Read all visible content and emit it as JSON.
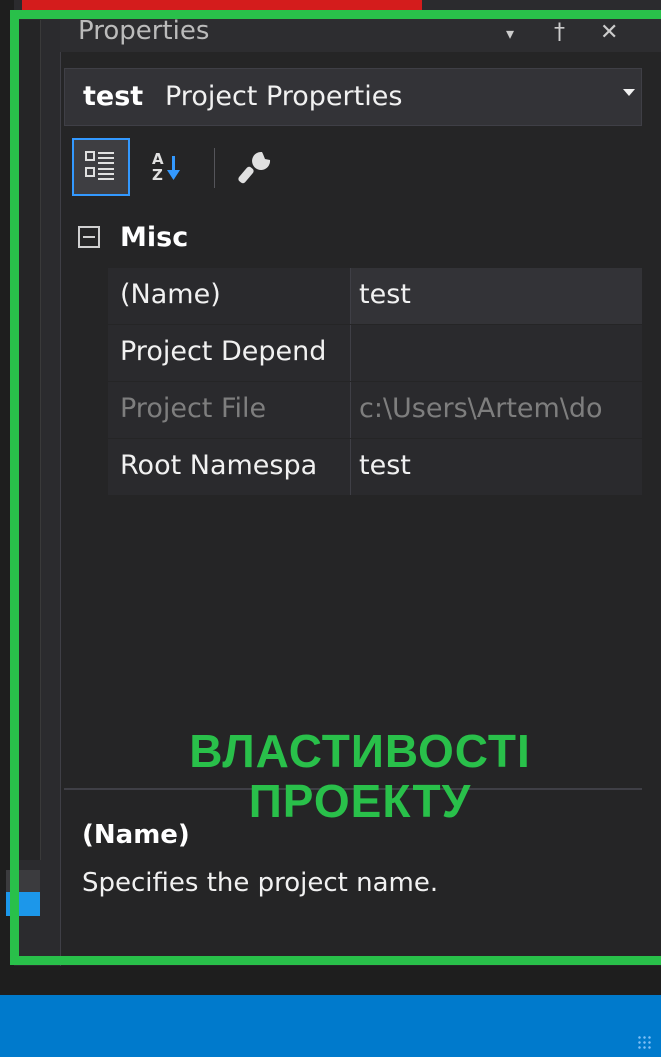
{
  "panel": {
    "title": "Properties",
    "pin_glyph": "†",
    "close_glyph": "✕",
    "menu_glyph": "▾"
  },
  "selector": {
    "object_name": "test",
    "object_type": "Project Properties"
  },
  "toolbar": {
    "buttons": [
      {
        "icon": "categorized-icon",
        "active": true
      },
      {
        "icon": "alphabetical-sort-icon",
        "active": false
      },
      {
        "icon": "property-pages-wrench-icon",
        "active": false
      }
    ]
  },
  "grid": {
    "category": "Misc",
    "rows": [
      {
        "name": "(Name)",
        "value": "test",
        "readonly": false
      },
      {
        "name": "Project Depend",
        "value": "",
        "readonly": false
      },
      {
        "name": "Project File",
        "value": "c:\\Users\\Artem\\do",
        "readonly": true
      },
      {
        "name": "Root Namespa",
        "value": "test",
        "readonly": false
      }
    ]
  },
  "description": {
    "title": "(Name)",
    "text": "Specifies the project name."
  },
  "overlay": {
    "line1": "ВЛАСТИВОСТІ",
    "line2": "ПРОЕКТУ",
    "color": "#29c04a"
  },
  "colors": {
    "accent_green": "#29c04a",
    "status_blue": "#007acc",
    "selection_blue": "#3399ff",
    "top_red": "#d41c1c"
  }
}
